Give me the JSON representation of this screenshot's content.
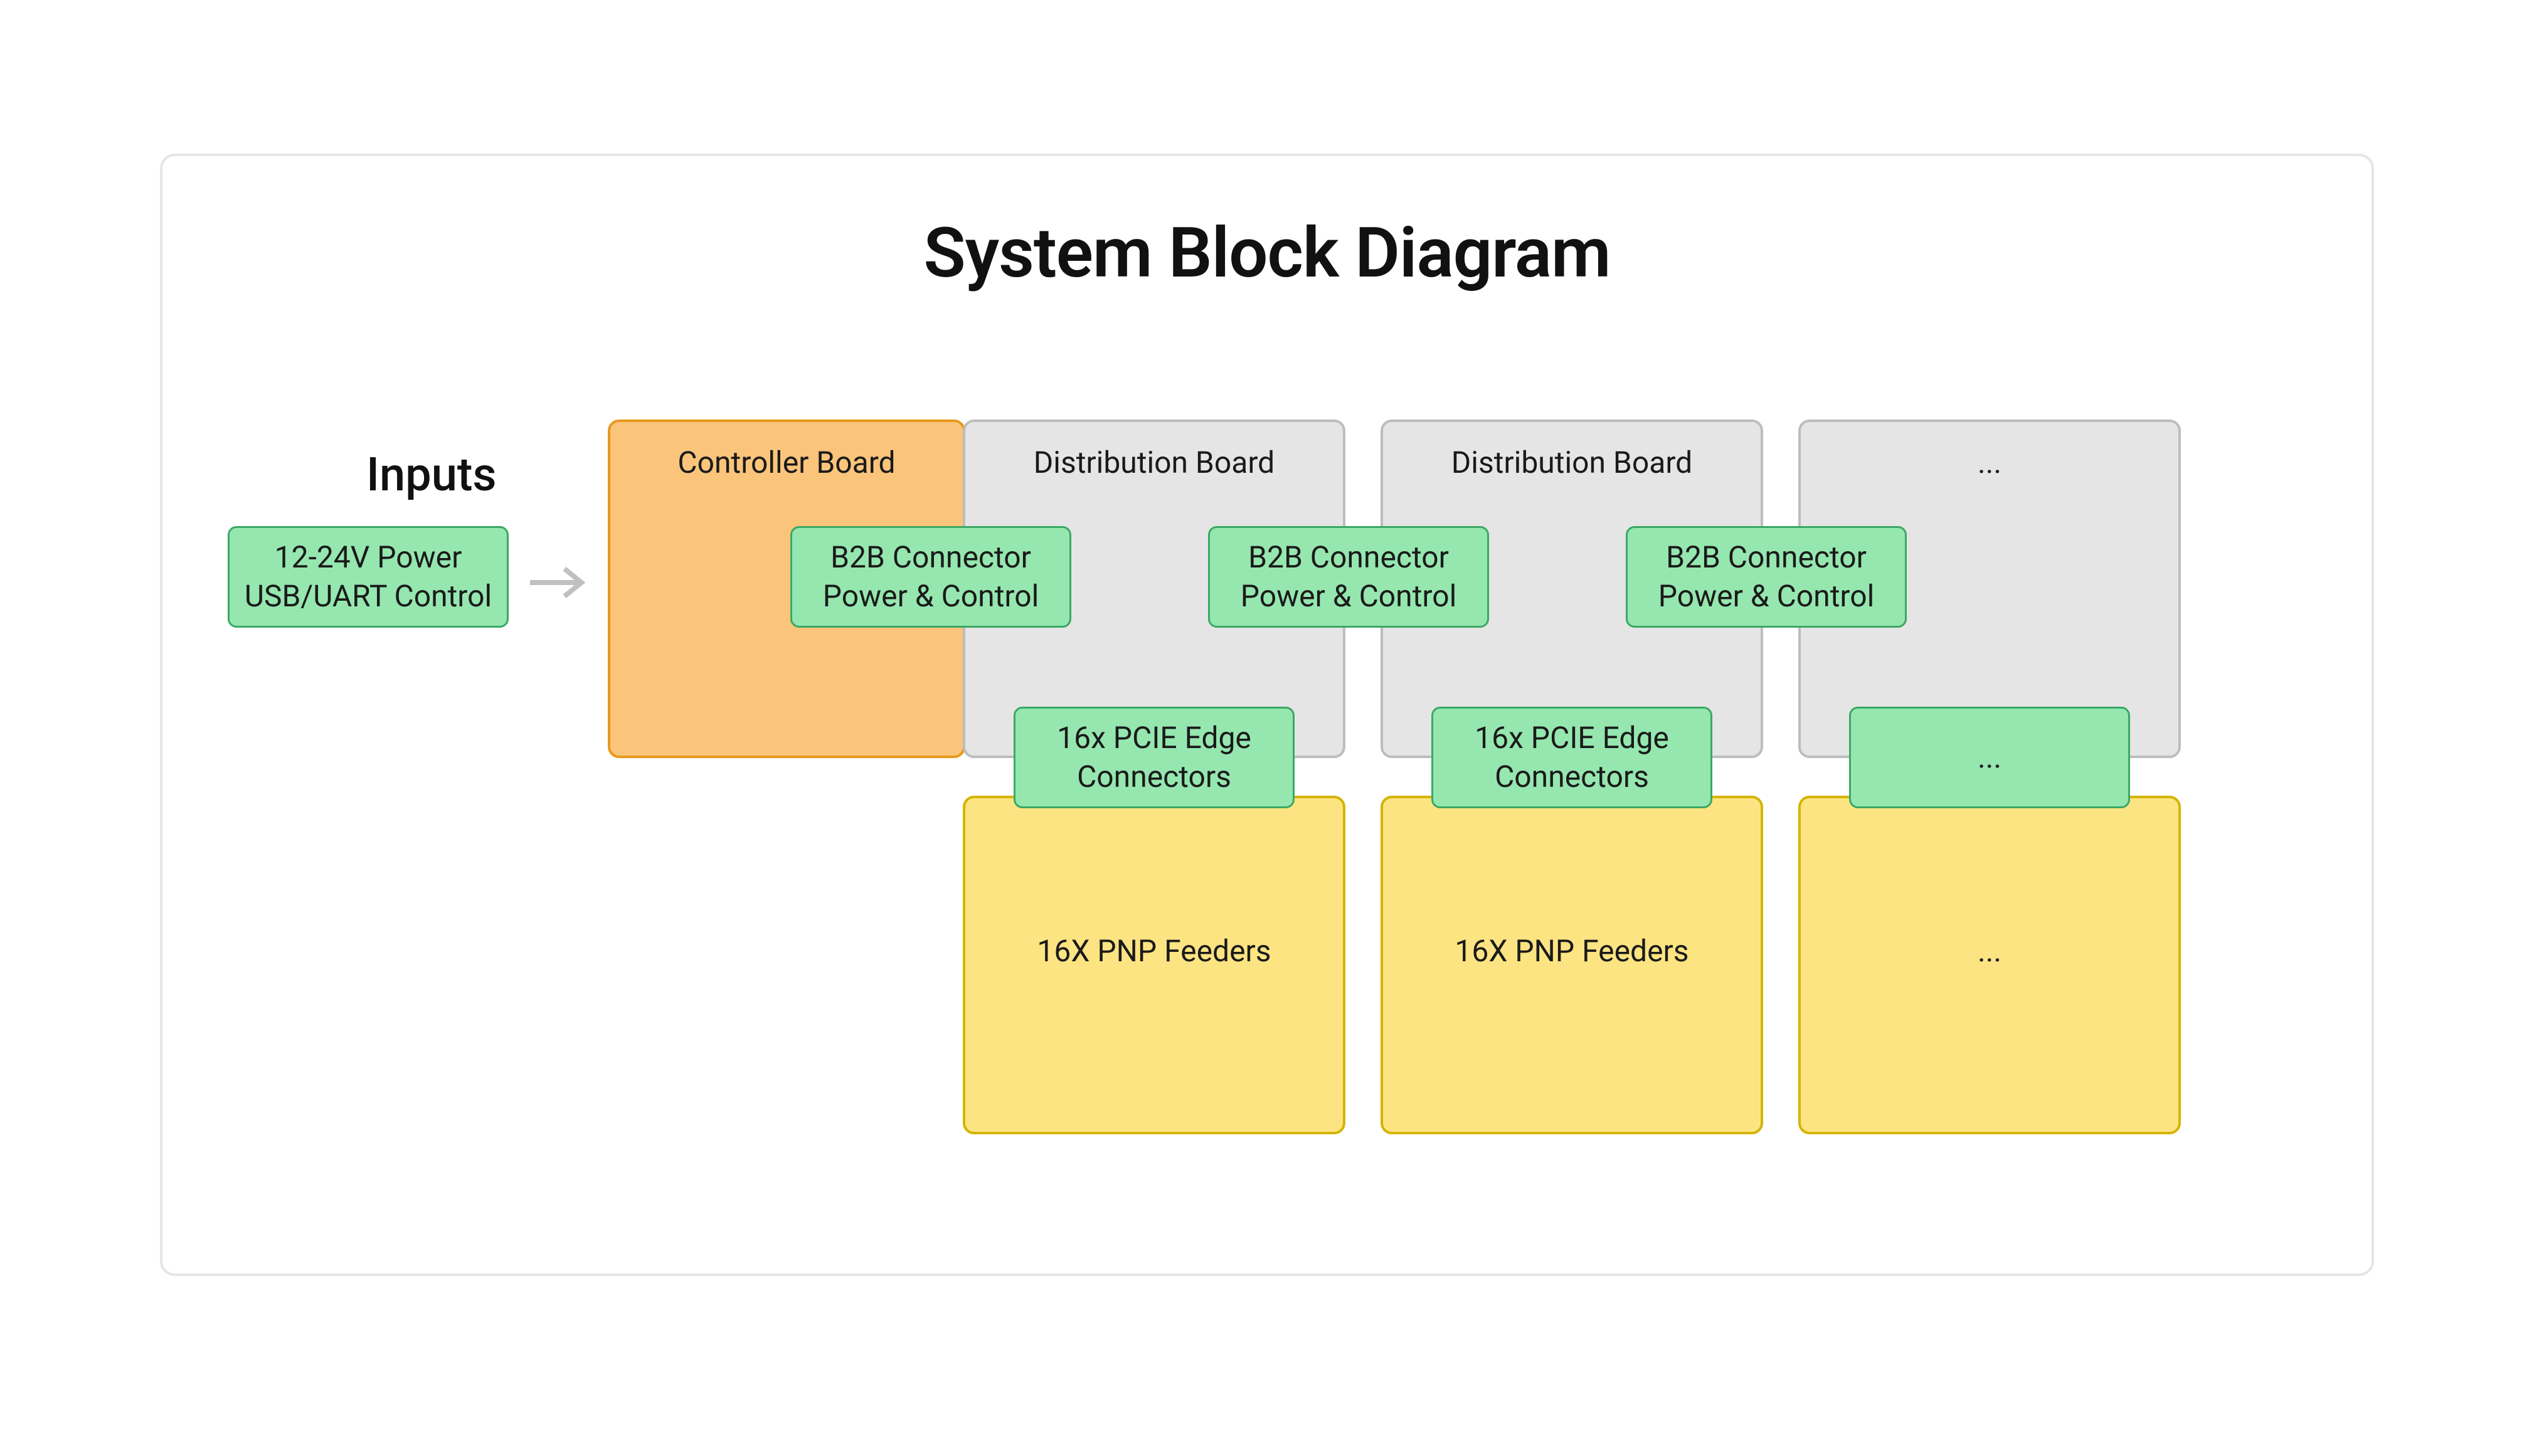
{
  "title": "System Block Diagram",
  "inputs": {
    "heading": "Inputs",
    "power_line": "12-24V Power",
    "control_line": "USB/UART Control"
  },
  "controller": {
    "title": "Controller Board"
  },
  "b2b": {
    "line1": "B2B Connector",
    "line2": "Power & Control"
  },
  "pcie": {
    "line1": "16x PCIE Edge",
    "line2": "Connectors"
  },
  "columns": [
    {
      "dist_title": "Distribution Board",
      "b2b_line1": "B2B Connector",
      "b2b_line2": "Power & Control",
      "pcie_line1": "16x PCIE Edge",
      "pcie_line2": "Connectors",
      "feeders_label": "16X PNP Feeders"
    },
    {
      "dist_title": "Distribution Board",
      "b2b_line1": "B2B Connector",
      "b2b_line2": "Power & Control",
      "pcie_line1": "16x PCIE Edge",
      "pcie_line2": "Connectors",
      "feeders_label": "16X PNP Feeders"
    },
    {
      "dist_title": "...",
      "b2b_line1": "B2B Connector",
      "b2b_line2": "Power & Control",
      "pcie_line1": "...",
      "pcie_line2": "",
      "feeders_label": "..."
    }
  ]
}
